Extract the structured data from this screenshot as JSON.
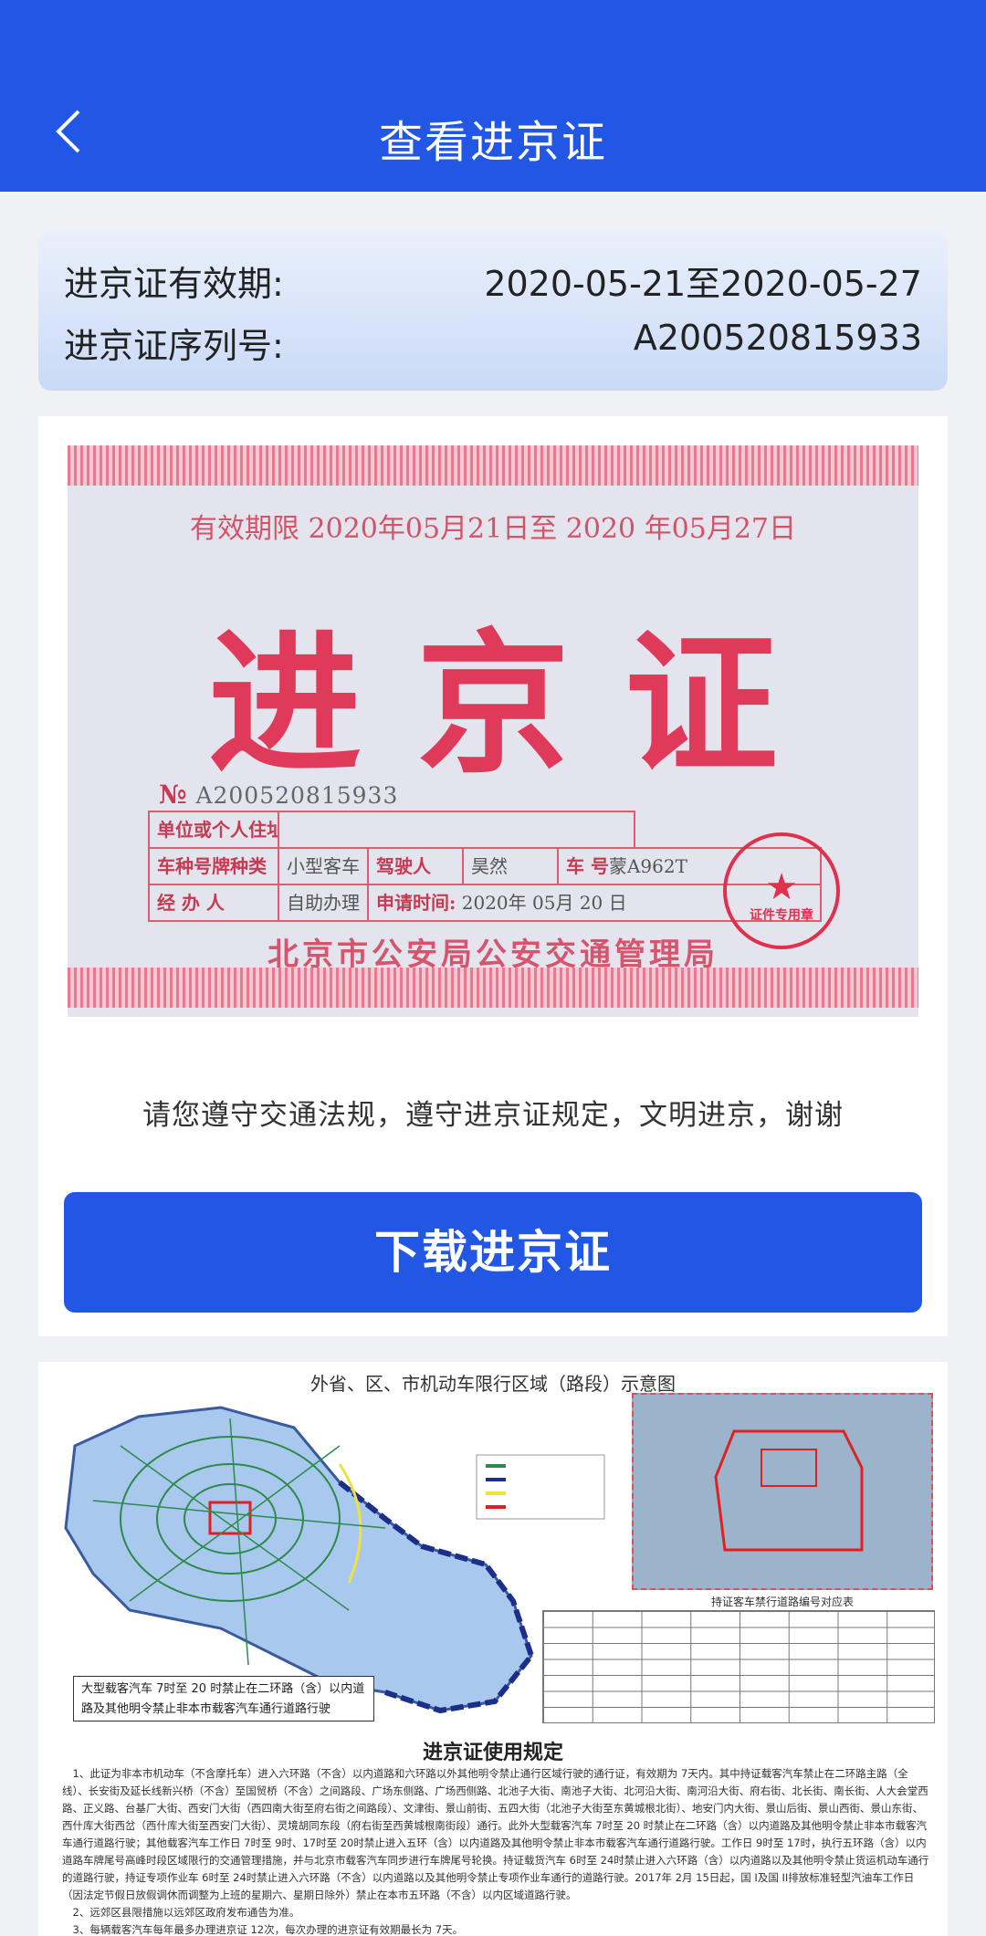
{
  "header": {
    "title": "查看进京证",
    "back_icon": "chevron-left-icon"
  },
  "info": {
    "validity_label": "进京证有效期:",
    "validity_value": "2020-05-21至2020-05-27",
    "serial_label": "进京证序列号:",
    "serial_value": "A200520815933"
  },
  "permit": {
    "validity_line": "有效期限 2020年05月21日至 2020 年05月27日",
    "big_title": "进京证",
    "number_label": "№",
    "number": "A200520815933",
    "address_label": "单位或个人住址",
    "vehicle_type_label": "车种号牌种类",
    "vehicle_type_value": "小型客车",
    "driver_label": "驾驶人",
    "driver_value": "昊然",
    "plate_label": "车 号",
    "plate_value": "蒙A962T",
    "handler_label": "经 办 人",
    "handler_value": "自助办理",
    "apply_label": "申请时间:",
    "apply_value": "2020年 05月 20 日",
    "bureau": "北京市公安局公安交通管理局",
    "stamp_text": "证件专用章"
  },
  "notice": "请您遵守交通法规，遵守进京证规定，文明进京，谢谢",
  "download_button": "下载进京证",
  "map": {
    "title": "外省、区、市机动车限行区域（路段）示意图",
    "restrict_note": "大型载客汽车 7时至 20 时禁止在二环路（含）以内道路及其他明令禁止非本市载客汽车通行道路行驶",
    "table_title": "持证客车禁行道路编号对应表",
    "rules_title": "进京证使用规定",
    "rules": [
      "1、此证为非本市机动车（不含摩托车）进入六环路（不含）以内道路和六环路以外其他明令禁止通行区域行驶的通行证，有效期为 7天内。其中持证载客汽车禁止在二环路主路（全线）、长安街及延长线新兴桥（不含）至国贸桥（不含）之间路段、广场东侧路、广场西侧路、北池子大街、南池子大街、北河沿大街、南河沿大街、府右街、北长街、南长街、人大会堂西路、正义路、台基厂大街、西安门大街（西四南大街至府右街之间路段）、文津街、景山前街、五四大街（北池子大街至东黄城根北街）、地安门内大街、景山后街、景山西街、景山东街、西什库大街西岔（西什库大街至西安门大街）、灵境胡同东段（府右街至西黄城根南街段）通行。此外大型载客汽车 7时至 20 时禁止在二环路（含）以内道路及其他明令禁止非本市载客汽车通行道路行驶；其他载客汽车工作日 7时至 9时、17时至 20时禁止进入五环（含）以内道路及其他明令禁止非本市载客汽车通行道路行驶。工作日 9时至 17时，执行五环路（含）以内道路车牌尾号高峰时段区域限行的交通管理措施，并与北京市载客汽车同步进行车牌尾号轮换。持证载货汽车 6时至 24时禁止进入六环路（含）以内道路以及其他明令禁止货运机动车通行的道路行驶，持证专项作业车 6时至 24时禁止进入六环路（不含）以内道路以及其他明令禁止专项作业车通行的道路行驶。2017年 2月 15日起，国 I及国 II排放标准轻型汽油车工作日（因法定节假日放假调休而调整为上班的星期六、星期日除外）禁止在本市五环路（不含）以内区域道路行驶。",
      "2、远郊区县限措施以远郊区政府发布通告为准。",
      "3、每辆载客汽车每年最多办理进京证 12次，每次办理的进京证有效期最长为 7天。"
    ]
  }
}
